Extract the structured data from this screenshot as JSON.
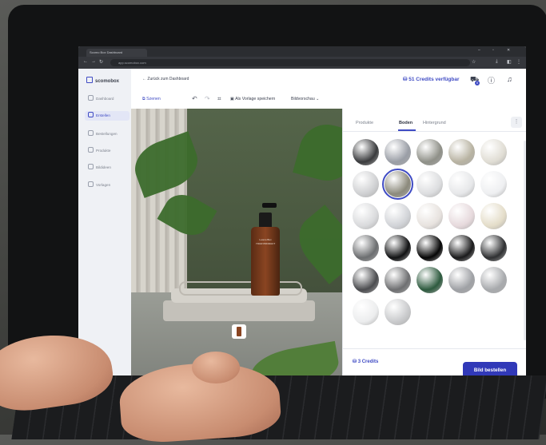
{
  "browser": {
    "tab_title": "Scomo Box Dashboard",
    "url": "app.scomobox.com",
    "minimize": "–",
    "maximize": "▫",
    "close": "✕"
  },
  "app": {
    "logo_text": "scomobox"
  },
  "sidebar": {
    "items": [
      {
        "label": "Dashboard",
        "icon": "grid-icon"
      },
      {
        "label": "Erstellen",
        "icon": "plus-icon",
        "active": true
      },
      {
        "label": "Bestellungen",
        "icon": "bag-icon"
      },
      {
        "label": "Produkte",
        "icon": "box-icon"
      },
      {
        "label": "Bildideen",
        "icon": "bulb-icon"
      },
      {
        "label": "Vorlagen",
        "icon": "layers-icon"
      }
    ]
  },
  "topbar": {
    "back_label": "← Zurück zum Dashboard",
    "credits_label": "51 Credits verfügbar",
    "cart_count": "0"
  },
  "toolbar": {
    "scenes_label": "Szenen",
    "undo_icon": "undo-icon",
    "redo_icon": "redo-icon",
    "crop_icon": "crop-icon",
    "save_template_label": "Als Vorlage speichern",
    "preview_label": "Bildvorschau ⌄"
  },
  "canvas": {
    "product_brand": "Loomo Box",
    "product_name": "YOUR PRODUCT"
  },
  "panel": {
    "tabs": [
      {
        "label": "Produkte",
        "active": false
      },
      {
        "label": "Boden",
        "active": true
      },
      {
        "label": "Hintergrund",
        "active": false
      }
    ],
    "more_label": "⋮",
    "footer_credits": "3 Credits",
    "order_button": "Bild bestellen"
  },
  "swatches": [
    {
      "color": "#3a3b3d",
      "name": "dark-granite"
    },
    {
      "color": "#9a9ea6",
      "name": "grey-stone"
    },
    {
      "color": "#8f9088",
      "name": "marble-grey"
    },
    {
      "color": "#b8b3a2",
      "name": "sandstone"
    },
    {
      "color": "#e0ddd4",
      "name": "cream-plaster"
    },
    {
      "color": "#cfd0d2",
      "name": "light-concrete"
    },
    {
      "color": "#8c8a7c",
      "name": "concrete-selected",
      "selected": true
    },
    {
      "color": "#dcdddf",
      "name": "white-stone"
    },
    {
      "color": "#e6e7e9",
      "name": "pale-grey"
    },
    {
      "color": "#eeeff1",
      "name": "off-white"
    },
    {
      "color": "#d9dadc",
      "name": "silver-white"
    },
    {
      "color": "#d1d3d7",
      "name": "mist"
    },
    {
      "color": "#e7e2de",
      "name": "warm-white"
    },
    {
      "color": "#e6d9dc",
      "name": "blush"
    },
    {
      "color": "#e4ddc9",
      "name": "ivory"
    },
    {
      "color": "#6c6e70",
      "name": "grey-marble"
    },
    {
      "color": "#111213",
      "name": "black-marble"
    },
    {
      "color": "#050505",
      "name": "black-glossy"
    },
    {
      "color": "#1a1a1b",
      "name": "black-stone"
    },
    {
      "color": "#2f3032",
      "name": "black-tile"
    },
    {
      "color": "#4b4c4f",
      "name": "dark-hex-tile"
    },
    {
      "color": "#6e6f71",
      "name": "checkerboard"
    },
    {
      "color": "#2d5a3e",
      "name": "green-checker"
    },
    {
      "color": "#9fa1a5",
      "name": "pattern-tile"
    },
    {
      "color": "#a8aaad",
      "name": "mosaic"
    },
    {
      "color": "#ecedee",
      "name": "white-plain"
    },
    {
      "color": "#c9cacc",
      "name": "soft-grey"
    }
  ]
}
